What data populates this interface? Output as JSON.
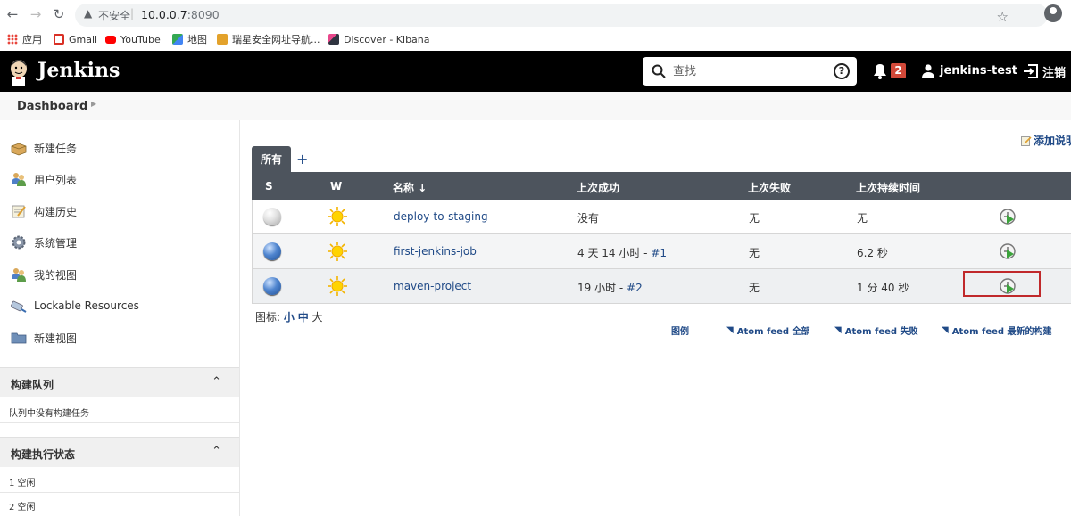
{
  "browser": {
    "insecure_label": "不安全",
    "url_host": "10.0.0.7",
    "url_port": ":8090",
    "bookmarks": [
      {
        "label": "应用",
        "color": "#e8453c"
      },
      {
        "label": "Gmail",
        "color": "#d93025"
      },
      {
        "label": "YouTube",
        "color": "#ff0000"
      },
      {
        "label": "地图",
        "color": "#34a853"
      },
      {
        "label": "瑞星安全网址导航...",
        "color": "#e37400"
      },
      {
        "label": "Discover - Kibana",
        "color": "#2f3440"
      }
    ]
  },
  "header": {
    "brand": "Jenkins",
    "search_placeholder": "查找",
    "notification_count": "2",
    "username": "jenkins-test",
    "logout_label": "注销"
  },
  "breadcrumb": {
    "items": [
      "Dashboard"
    ]
  },
  "sidebar": {
    "items": [
      {
        "label": "新建任务"
      },
      {
        "label": "用户列表"
      },
      {
        "label": "构建历史"
      },
      {
        "label": "系统管理"
      },
      {
        "label": "我的视图"
      },
      {
        "label": "Lockable Resources"
      },
      {
        "label": "新建视图"
      }
    ],
    "build_queue": {
      "title": "构建队列",
      "empty_text": "队列中没有构建任务"
    },
    "executors": {
      "title": "构建执行状态",
      "items": [
        "1  空闲",
        "2  空闲"
      ]
    }
  },
  "main": {
    "add_description": "添加说明",
    "tab_all": "所有",
    "tab_add": "+",
    "columns": {
      "s": "S",
      "w": "W",
      "name": "名称 ↓",
      "last_success": "上次成功",
      "last_failure": "上次失败",
      "last_duration": "上次持续时间"
    },
    "jobs": [
      {
        "status": "grey",
        "name": "deploy-to-staging",
        "last_success": "没有",
        "last_success_build": "",
        "last_failure": "无",
        "last_duration": "无"
      },
      {
        "status": "blue",
        "name": "first-jenkins-job",
        "last_success": "4 天 14 小时 - ",
        "last_success_build": "#1",
        "last_failure": "无",
        "last_duration": "6.2 秒"
      },
      {
        "status": "blue",
        "name": "maven-project",
        "last_success": "19 小时 - ",
        "last_success_build": "#2",
        "last_failure": "无",
        "last_duration": "1 分 40 秒"
      }
    ],
    "icon_size_label": "图标: ",
    "icon_sizes": {
      "small": "小",
      "medium": "中",
      "large": "大"
    },
    "feeds": {
      "legend": "图例",
      "all": "Atom feed 全部",
      "failed": "Atom feed 失败",
      "latest": "Atom feed 最新的构建"
    }
  },
  "colors": {
    "header_bg": "#000000",
    "table_header_bg": "#4d545d",
    "link": "#204a87",
    "badge": "#d24939",
    "highlight_box": "#c0292b"
  }
}
